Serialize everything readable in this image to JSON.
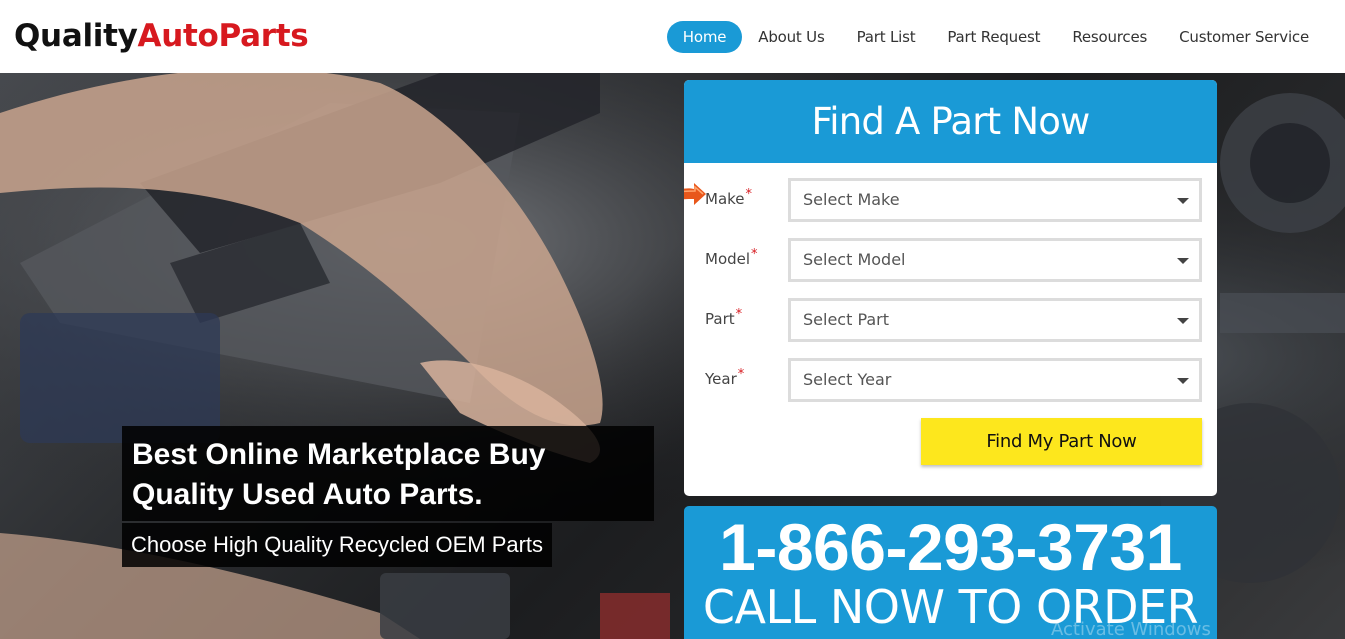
{
  "logo": {
    "part1": "Quality",
    "part2": "AutoParts"
  },
  "nav": [
    "Home",
    "About Us",
    "Part List",
    "Part Request",
    "Resources",
    "Customer Service"
  ],
  "hero": {
    "headline": "Best Online Marketplace Buy Quality Used Auto Parts.",
    "subline": "Choose High Quality Recycled OEM Parts"
  },
  "form": {
    "title": "Find A Part Now",
    "fields": [
      {
        "label": "Make",
        "placeholder": "Select Make"
      },
      {
        "label": "Model",
        "placeholder": "Select Model"
      },
      {
        "label": "Part",
        "placeholder": "Select Part"
      },
      {
        "label": "Year",
        "placeholder": "Select Year"
      }
    ],
    "required_mark": "*",
    "submit_label": "Find My Part Now"
  },
  "call": {
    "phone": "1-866-293-3731",
    "cta": "CALL NOW TO ORDER"
  },
  "watermark": "Activate Windows",
  "colors": {
    "brand_blue": "#1a9ad6",
    "brand_red": "#d7191f",
    "button_yellow": "#fde71d"
  }
}
